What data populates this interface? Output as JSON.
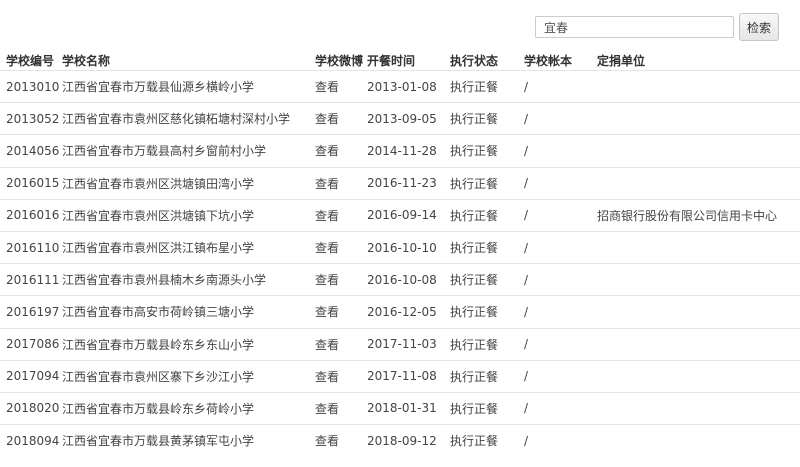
{
  "search": {
    "value": "宜春",
    "button_label": "检索"
  },
  "table": {
    "headers": {
      "id": "学校编号",
      "name": "学校名称",
      "weibo": "学校微博",
      "start_date": "开餐时间",
      "status": "执行状态",
      "account": "学校帐本",
      "donor": "定捐单位"
    },
    "rows": [
      {
        "id": "2013010",
        "name": "江西省宜春市万载县仙源乡横岭小学",
        "weibo": "查看",
        "start_date": "2013-01-08",
        "status": "执行正餐",
        "account": "/",
        "donor": ""
      },
      {
        "id": "2013052",
        "name": "江西省宜春市袁州区慈化镇柘塘村深村小学",
        "weibo": "查看",
        "start_date": "2013-09-05",
        "status": "执行正餐",
        "account": "/",
        "donor": ""
      },
      {
        "id": "2014056",
        "name": "江西省宜春市万载县高村乡窗前村小学",
        "weibo": "查看",
        "start_date": "2014-11-28",
        "status": "执行正餐",
        "account": "/",
        "donor": ""
      },
      {
        "id": "2016015",
        "name": "江西省宜春市袁州区洪塘镇田湾小学",
        "weibo": "查看",
        "start_date": "2016-11-23",
        "status": "执行正餐",
        "account": "/",
        "donor": ""
      },
      {
        "id": "2016016",
        "name": "江西省宜春市袁州区洪塘镇下坑小学",
        "weibo": "查看",
        "start_date": "2016-09-14",
        "status": "执行正餐",
        "account": "/",
        "donor": "招商银行股份有限公司信用卡中心"
      },
      {
        "id": "2016110",
        "name": "江西省宜春市袁州区洪江镇布星小学",
        "weibo": "查看",
        "start_date": "2016-10-10",
        "status": "执行正餐",
        "account": "/",
        "donor": ""
      },
      {
        "id": "2016111",
        "name": "江西省宜春市袁州县楠木乡南源头小学",
        "weibo": "查看",
        "start_date": "2016-10-08",
        "status": "执行正餐",
        "account": "/",
        "donor": ""
      },
      {
        "id": "2016197",
        "name": "江西省宜春市高安市荷岭镇三塘小学",
        "weibo": "查看",
        "start_date": "2016-12-05",
        "status": "执行正餐",
        "account": "/",
        "donor": ""
      },
      {
        "id": "2017086",
        "name": "江西省宜春市万载县岭东乡东山小学",
        "weibo": "查看",
        "start_date": "2017-11-03",
        "status": "执行正餐",
        "account": "/",
        "donor": ""
      },
      {
        "id": "2017094",
        "name": "江西省宜春市袁州区寨下乡沙江小学",
        "weibo": "查看",
        "start_date": "2017-11-08",
        "status": "执行正餐",
        "account": "/",
        "donor": ""
      },
      {
        "id": "2018020",
        "name": "江西省宜春市万载县岭东乡荷岭小学",
        "weibo": "查看",
        "start_date": "2018-01-31",
        "status": "执行正餐",
        "account": "/",
        "donor": ""
      },
      {
        "id": "2018094",
        "name": "江西省宜春市万载县黄茅镇军屯小学",
        "weibo": "查看",
        "start_date": "2018-09-12",
        "status": "执行正餐",
        "account": "/",
        "donor": ""
      }
    ]
  }
}
